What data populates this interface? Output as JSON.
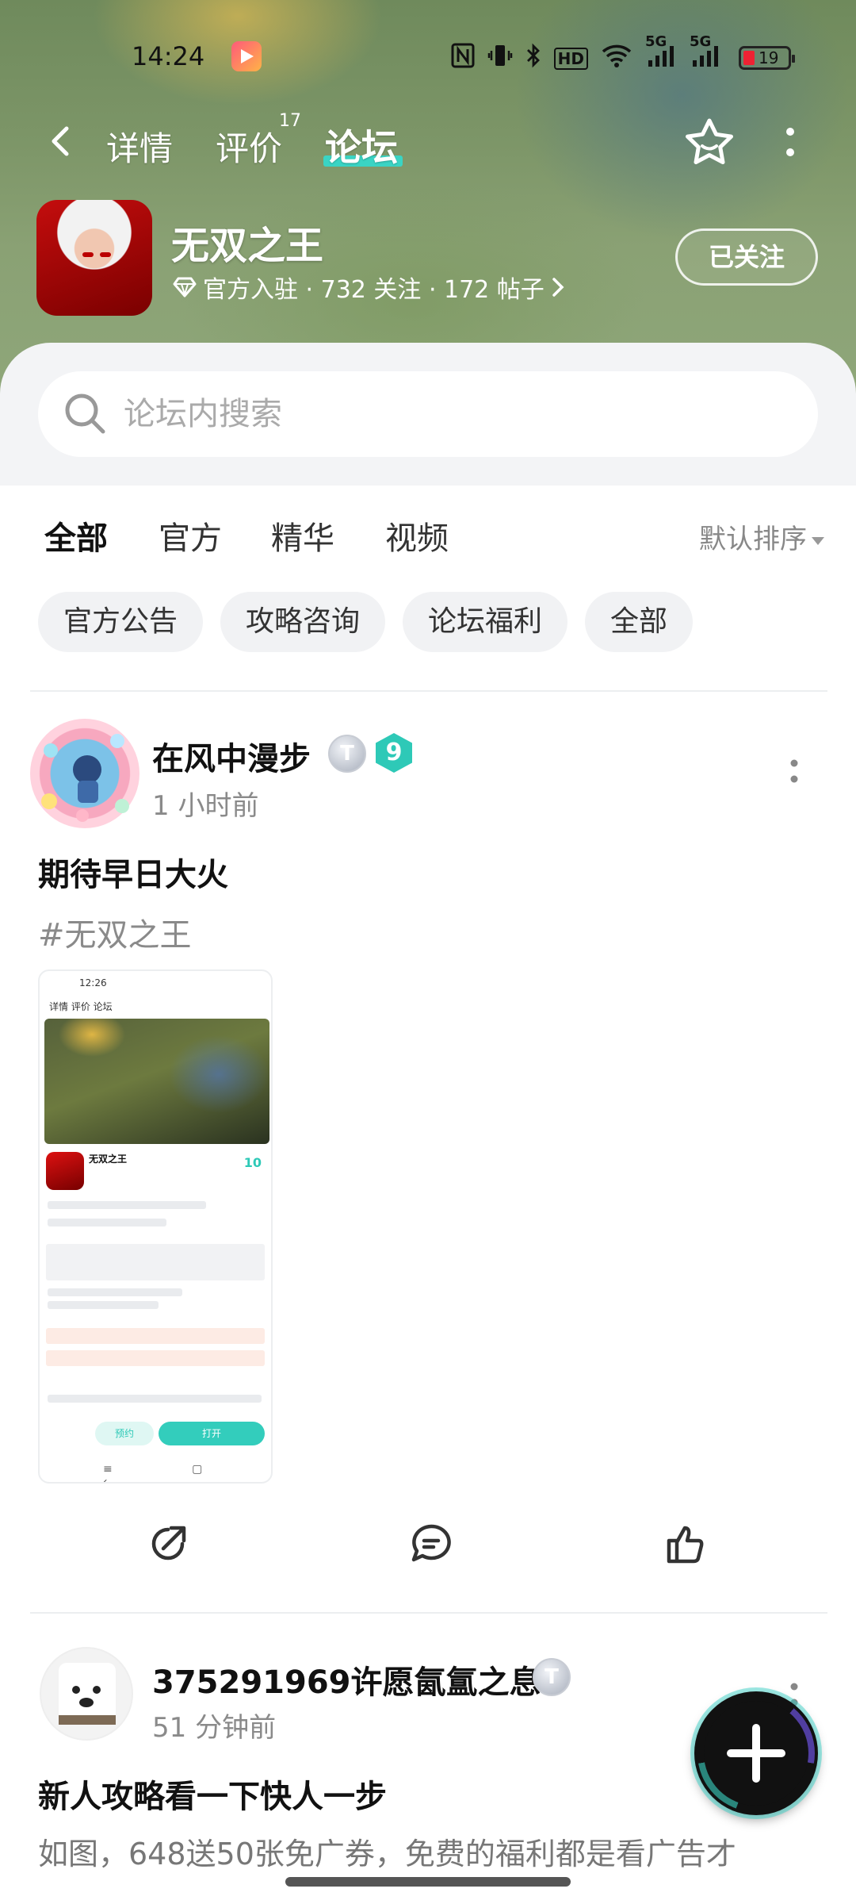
{
  "status_bar": {
    "time": "14:24",
    "battery": "19",
    "icons": [
      "nfc-icon",
      "vibrate-icon",
      "bluetooth-icon",
      "hd-icon",
      "wifi-icon",
      "signal-5g-icon",
      "signal-5g-icon",
      "battery-icon"
    ],
    "hd_label": "HD",
    "net1": "5G",
    "net2": "5G"
  },
  "nav": {
    "tabs": [
      {
        "label": "详情"
      },
      {
        "label": "评价",
        "count": "17"
      },
      {
        "label": "论坛"
      }
    ],
    "accent": "#3ad4c4"
  },
  "game": {
    "name": "无双之王",
    "meta": "官方入驻 · 732 关注 · 172 帖子",
    "follow_label": "已关注"
  },
  "search": {
    "placeholder": "论坛内搜索"
  },
  "category_tabs": [
    {
      "label": "全部"
    },
    {
      "label": "官方"
    },
    {
      "label": "精华"
    },
    {
      "label": "视频"
    }
  ],
  "sort_label": "默认排序",
  "chips": [
    "官方公告",
    "攻略咨询",
    "论坛福利",
    "全部"
  ],
  "posts": [
    {
      "author": "在风中漫步",
      "badge_t": "T",
      "level": "9",
      "time": "1 小时前",
      "title": "期待早日大火",
      "tag": "#无双之王",
      "thumbnail": {
        "time": "12:26",
        "tabs": "详情  评价  论坛",
        "name": "无双之王",
        "score": "10",
        "btn1": "预约",
        "btn2": "打开",
        "nav": "≡ ▢ ‹"
      }
    },
    {
      "author": "375291969许愿氤氲之息",
      "badge_t": "T",
      "time": "51 分钟前",
      "title": "新人攻略看一下快人一步",
      "body": "如图，648送50张免广券，免费的福利都是看广告才"
    }
  ]
}
